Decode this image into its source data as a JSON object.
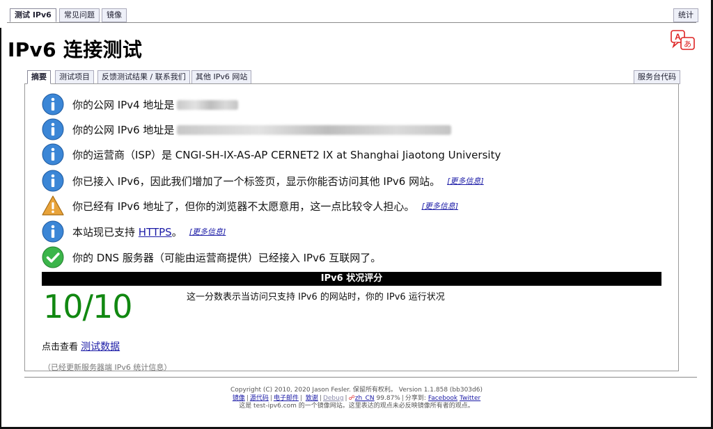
{
  "top_tabs": {
    "test": "测试 IPv6",
    "faq": "常见问题",
    "mirrors": "镜像",
    "stats": "统计"
  },
  "page_title": "IPv6 连接测试",
  "sub_tabs": {
    "summary": "摘要",
    "tests": "测试项目",
    "feedback": "反馈测试结果 / 联系我们",
    "other_sites": "其他 IPv6 网站",
    "console": "服务台代码"
  },
  "results": [
    {
      "icon": "info-icon",
      "text": "你的公网 IPv4 地址是"
    },
    {
      "icon": "info-icon",
      "text": "你的公网 IPv6 地址是"
    },
    {
      "icon": "info-icon",
      "text": "你的运营商（ISP）是 CNGI-SH-IX-AS-AP CERNET2 IX at Shanghai Jiaotong University"
    },
    {
      "icon": "info-icon",
      "text": "你已接入 IPv6，因此我们增加了一个标签页，显示你能否访问其他 IPv6 网站。",
      "more": "[更多信息]"
    },
    {
      "icon": "warning-icon",
      "text": "你已经有 IPv6 地址了，但你的浏览器不太愿意用，这一点比较令人担心。",
      "more": "[更多信息]"
    },
    {
      "icon": "info-icon",
      "text_before": "本站现已支持",
      "link": "HTTPS",
      "text_after": "。",
      "more": "[更多信息]"
    },
    {
      "icon": "check-icon",
      "text": "你的 DNS 服务器（可能由运营商提供）已经接入 IPv6 互联网了。"
    }
  ],
  "score": {
    "header": "IPv6 状况评分",
    "value": "10/10",
    "description": "这一分数表示当访问只支持 IPv6 的网站时，你的 IPv6 运行状况"
  },
  "check_data": {
    "prefix": "点击查看",
    "link": "测试数据"
  },
  "updated_note": "（已经更新服务器端 IPv6 统计信息）",
  "colors": {
    "score_green": "#118811",
    "info_blue": "#3b86d6",
    "warning_orange": "#e8a33a",
    "check_green": "#3bb54a",
    "link_blue": "#1a1aa6"
  },
  "footer": {
    "copyright": "Copyright (C) 2010, 2020 Jason Fesler. 保留所有权利。 Version 1.1.858 (bb303d6)",
    "mirrors": "镜像",
    "source": "源代码",
    "email": "电子邮件",
    "thanks": "致谢",
    "debug": "Debug",
    "locale": "zh_CN",
    "percent": "99.87%",
    "share_label": "分享到:",
    "facebook": "Facebook",
    "twitter": "Twitter",
    "disclaimer": "这是 test-ipv6.com 的一个镜像网站。这里表达的观点未必反映镜像所有者的观点。"
  }
}
